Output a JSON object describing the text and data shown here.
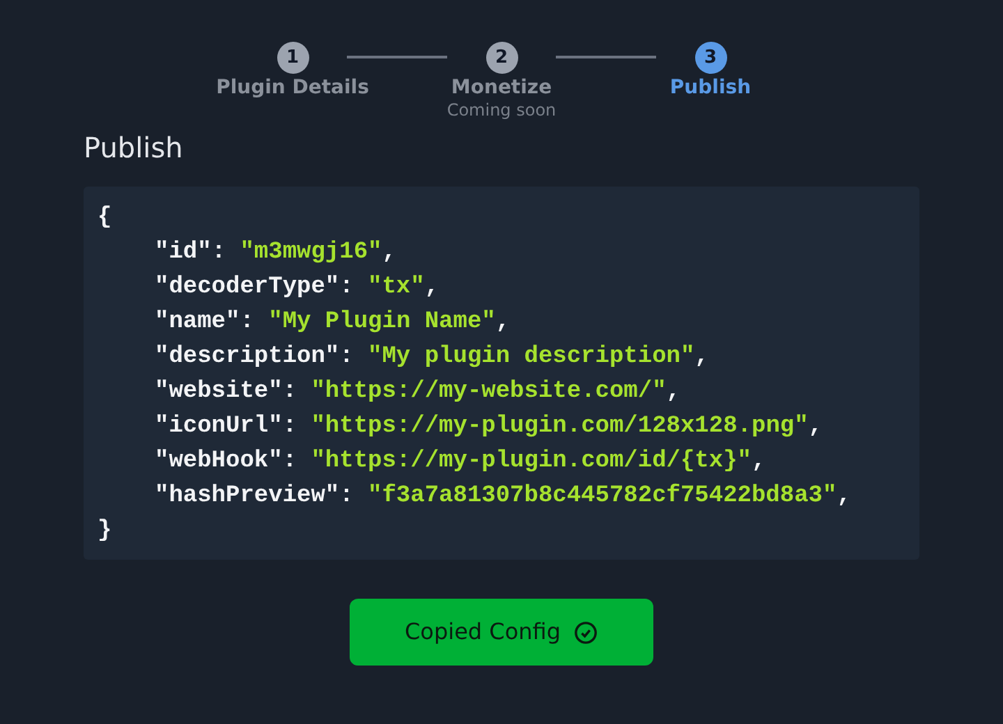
{
  "steps": [
    {
      "number": "1",
      "label": "Plugin Details",
      "selected": false
    },
    {
      "number": "2",
      "label": "Monetize",
      "sublabel": "Coming soon",
      "selected": false
    },
    {
      "number": "3",
      "label": "Publish",
      "selected": true
    }
  ],
  "heading": "Publish",
  "code_lines": [
    {
      "kind": "brace",
      "text": "{"
    },
    {
      "kind": "pair",
      "key": "\"id\"",
      "sep": ": ",
      "value": "\"m3mwgj16\"",
      "end": ","
    },
    {
      "kind": "pair",
      "key": "\"decoderType\"",
      "sep": ": ",
      "value": "\"tx\"",
      "end": ","
    },
    {
      "kind": "pair",
      "key": "\"name\"",
      "sep": ": ",
      "value": "\"My Plugin Name\"",
      "end": ","
    },
    {
      "kind": "pair",
      "key": "\"description\"",
      "sep": ": ",
      "value": "\"My plugin description\"",
      "end": ","
    },
    {
      "kind": "pair",
      "key": "\"website\"",
      "sep": ": ",
      "value": "\"https://my-website.com/\"",
      "end": ","
    },
    {
      "kind": "pair",
      "key": "\"iconUrl\"",
      "sep": ": ",
      "value": "\"https://my-plugin.com/128x128.png\"",
      "end": ","
    },
    {
      "kind": "pair",
      "key": "\"webHook\"",
      "sep": ": ",
      "value": "\"https://my-plugin.com/id/{tx}\"",
      "end": ","
    },
    {
      "kind": "pair",
      "key": "\"hashPreview\"",
      "sep": ": ",
      "value": "\"f3a7a81307b8c445782cf75422bd8a3\"",
      "end": ","
    },
    {
      "kind": "brace",
      "text": "}"
    }
  ],
  "copy_button": {
    "label": "Copied Config",
    "copied": true
  }
}
